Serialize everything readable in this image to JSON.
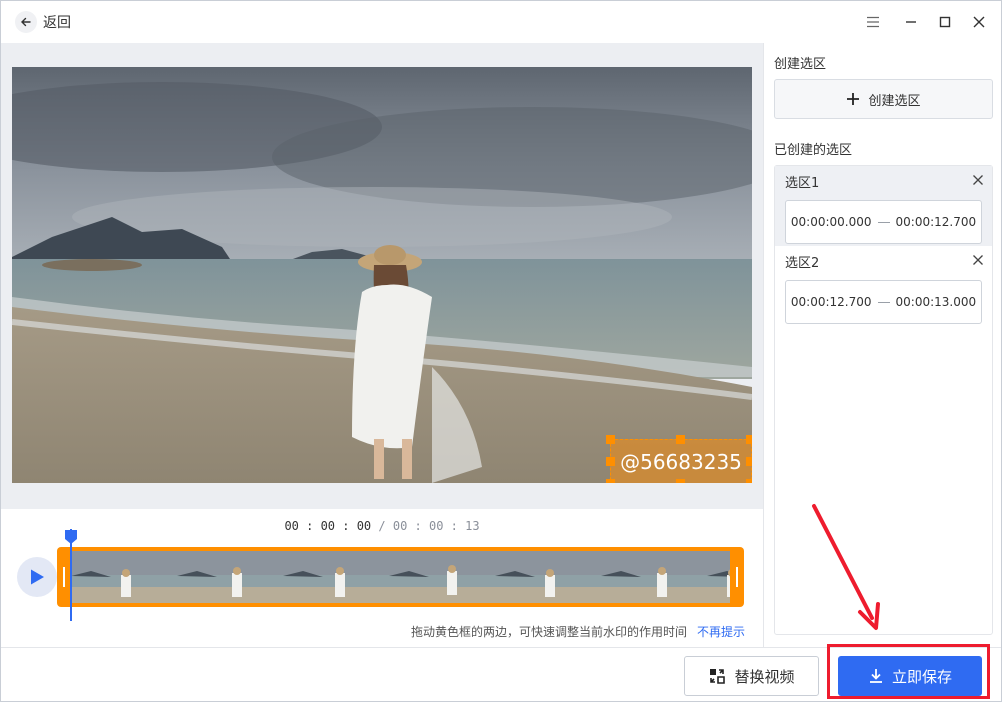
{
  "titlebar": {
    "back_label": "返回",
    "controls": [
      "menu-icon",
      "minimize-icon",
      "maximize-icon",
      "close-icon"
    ]
  },
  "preview": {
    "watermark_text": "@56683235"
  },
  "timeline": {
    "current_time": "00 : 00 : 00",
    "separator": " / ",
    "total_time": "00 : 00 : 13",
    "hint": "拖动黄色框的两边，可快速调整当前水印的作用时间",
    "hint_link": "不再提示",
    "play_icon": "play-icon"
  },
  "right_panel": {
    "create_heading": "创建选区",
    "create_button": "创建选区",
    "created_heading": "已创建的选区",
    "selections": [
      {
        "title": "选区1",
        "start": "00:00:00.000",
        "end": "00:00:12.700"
      },
      {
        "title": "选区2",
        "start": "00:00:12.700",
        "end": "00:00:13.000"
      }
    ]
  },
  "footer": {
    "replace_label": "替换视频",
    "save_label": "立即保存"
  },
  "colors": {
    "accent": "#2f6bf2",
    "track": "#ff8f00",
    "annotation": "#ee1c2e"
  }
}
